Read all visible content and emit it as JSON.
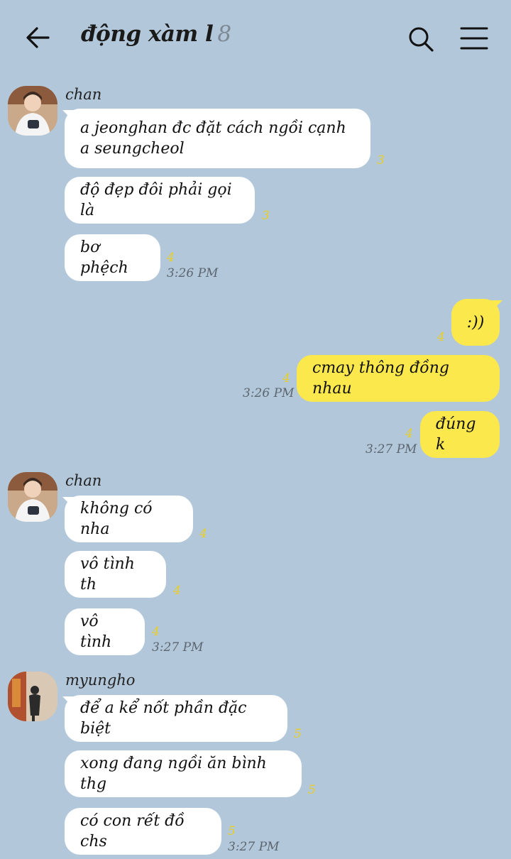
{
  "header": {
    "title": "động xàm l",
    "member_count": "8"
  },
  "colors": {
    "background": "#b2c7d9",
    "my_bubble": "#fbe84c",
    "other_bubble": "#ffffff",
    "unread": "#e9cf25",
    "time": "#5c6670"
  },
  "icons": {
    "back": "arrow-left-icon",
    "search": "search-icon",
    "menu": "hamburger-menu-icon"
  },
  "groups": [
    {
      "sender": "chan",
      "messages": [
        {
          "text": "a jeonghan đc đặt cách ngồi cạnh a seungcheol",
          "unread": "3"
        },
        {
          "text": "độ đẹp đôi phải gọi là",
          "unread": "3"
        },
        {
          "text": "bơ phệch",
          "unread": "4",
          "time": "3:26 PM"
        }
      ]
    },
    {
      "sender": "me",
      "messages": [
        {
          "text": ":))",
          "unread": "4"
        },
        {
          "text": "cmay thông đồng nhau",
          "unread": "4",
          "time": "3:26 PM"
        },
        {
          "text": "đúng k",
          "unread": "4",
          "time": "3:27 PM"
        }
      ]
    },
    {
      "sender": "chan",
      "messages": [
        {
          "text": "không có nha",
          "unread": "4"
        },
        {
          "text": "vô tình th",
          "unread": "4"
        },
        {
          "text": "vô tình",
          "unread": "4",
          "time": "3:27 PM"
        }
      ]
    },
    {
      "sender": "myungho",
      "messages": [
        {
          "text": "để a kể nốt phần đặc biệt",
          "unread": "5"
        },
        {
          "text": "xong đang ngồi ăn bình thg",
          "unread": "5"
        },
        {
          "text": "có con rết đồ chs",
          "unread": "5",
          "time": "3:27 PM"
        }
      ]
    }
  ]
}
